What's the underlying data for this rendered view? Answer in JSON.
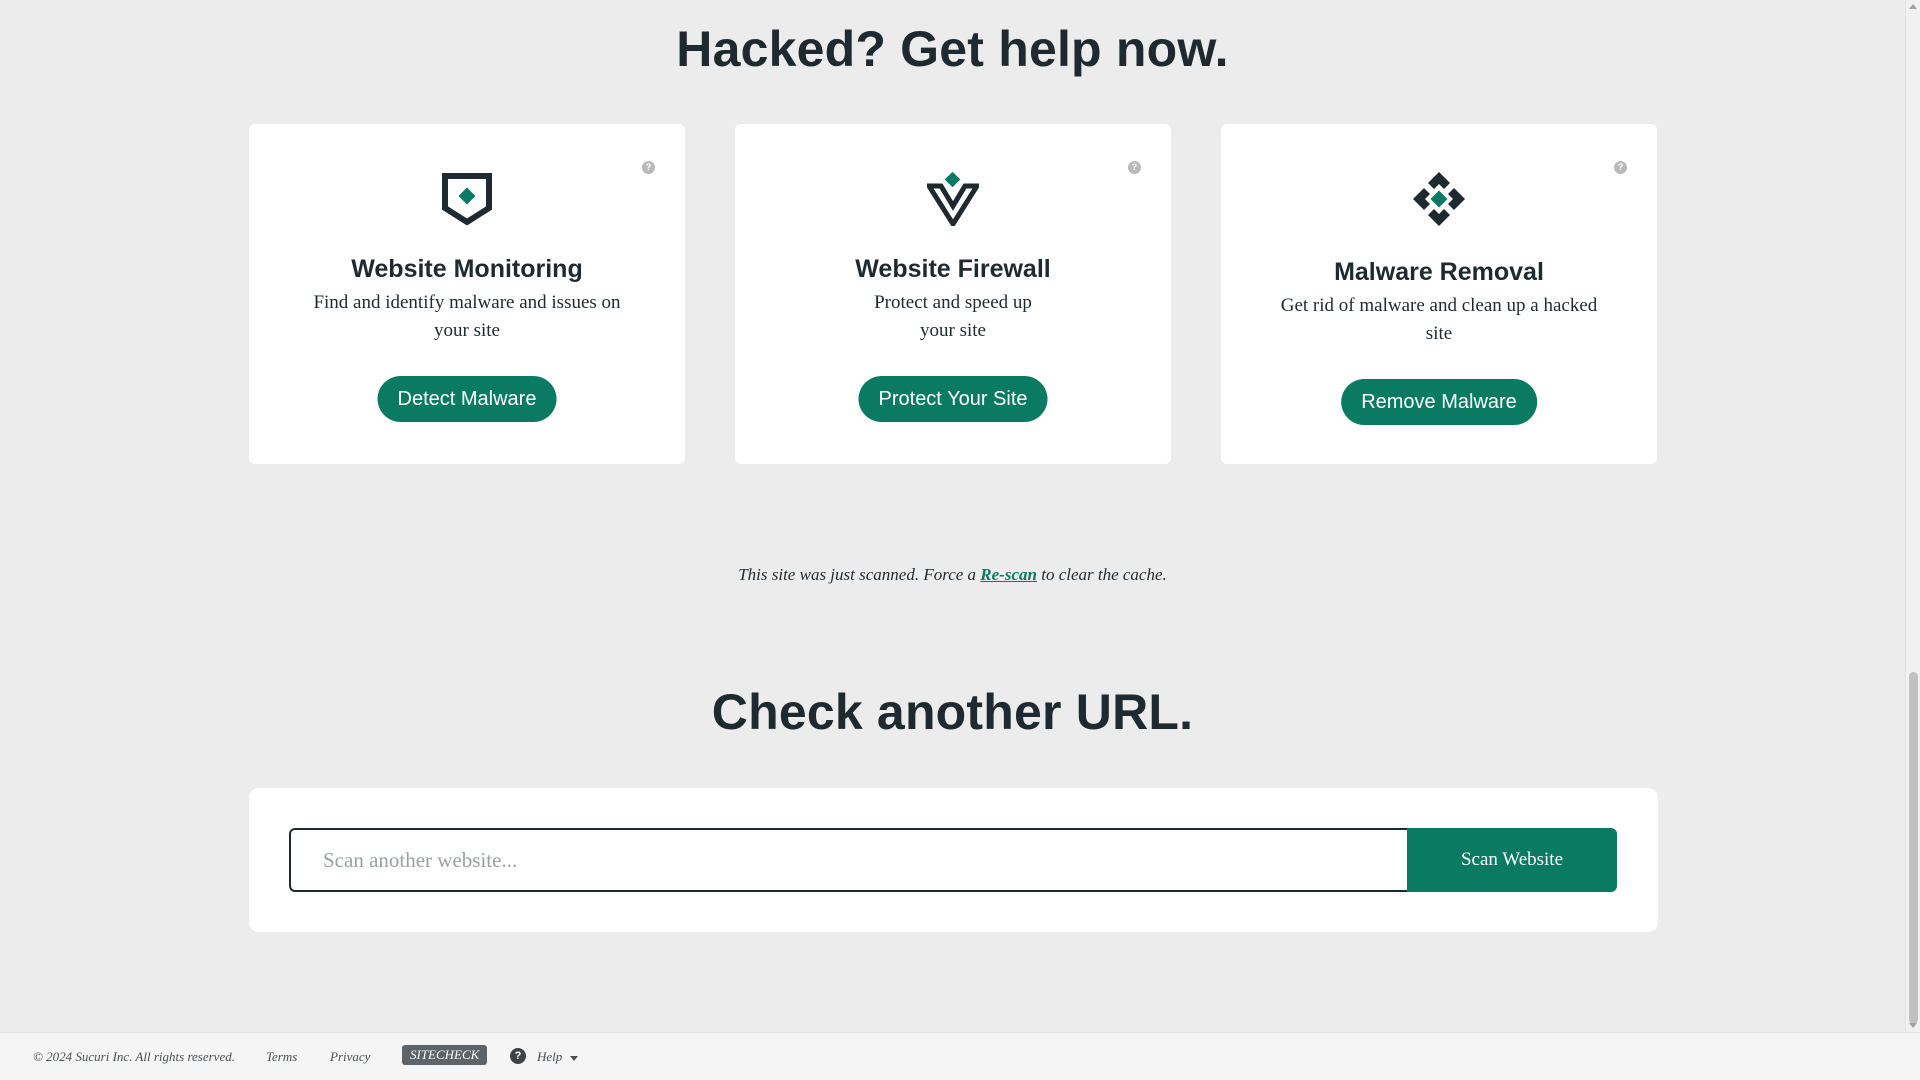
{
  "sections": {
    "hacked_title": "Hacked? Get help now.",
    "check_title": "Check another URL."
  },
  "colors": {
    "accent": "#0a7b62",
    "dark": "#1f2a30",
    "background": "#ececec"
  },
  "cards": [
    {
      "icon": "shield-diamond-icon",
      "title": "Website Monitoring",
      "desc_line1": "Find and identify malware and issues on",
      "desc_line2": "your site",
      "button": "Detect Malware",
      "help": "?"
    },
    {
      "icon": "firewall-v-icon",
      "title": "Website Firewall",
      "desc_line1": "Protect and speed up",
      "desc_line2": "your site",
      "button": "Protect Your Site",
      "help": "?"
    },
    {
      "icon": "malware-removal-icon",
      "title": "Malware Removal",
      "desc_line1": "Get rid of malware and clean up a hacked",
      "desc_line2": "site",
      "button": "Remove Malware",
      "help": "?"
    }
  ],
  "scan_note": {
    "before": "This site was just scanned. Force a ",
    "link": "Re-scan",
    "after": " to clear the cache."
  },
  "scan_form": {
    "placeholder": "Scan another website...",
    "value": "",
    "button": "Scan Website"
  },
  "footer": {
    "copyright": "© 2024 Sucuri Inc. All rights reserved.",
    "terms": "Terms",
    "privacy": "Privacy",
    "badge": "SITECHECK",
    "help_icon": "?",
    "help": "Help"
  }
}
